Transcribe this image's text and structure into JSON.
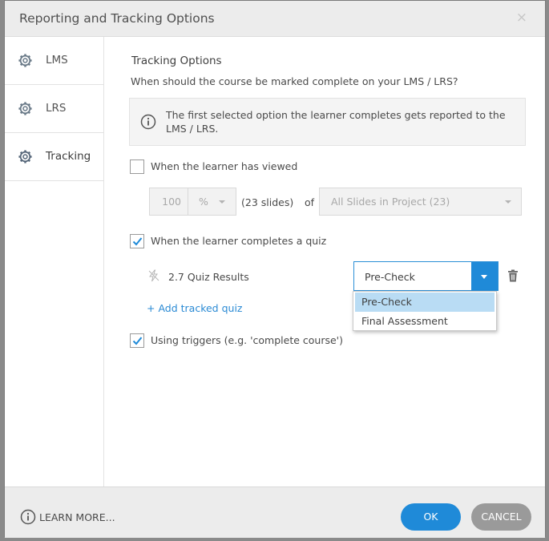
{
  "dialog": {
    "title": "Reporting and Tracking Options",
    "close_glyph": "×"
  },
  "sidebar": {
    "items": [
      {
        "label": "LMS",
        "icon": "gear-icon",
        "active": false
      },
      {
        "label": "LRS",
        "icon": "gear-icon",
        "active": false
      },
      {
        "label": "Tracking",
        "icon": "gear-icon",
        "active": true
      }
    ]
  },
  "tracking": {
    "title": "Tracking Options",
    "question": "When should the course be marked complete on your LMS / LRS?",
    "info": "The first selected option the learner completes gets reported to the LMS / LRS.",
    "viewed": {
      "label": "When the learner has viewed",
      "checked": false,
      "percent_value": "100",
      "unit": "%",
      "slides_count": "(23 slides)",
      "of_label": "of",
      "slides_select": "All Slides in Project (23)"
    },
    "quiz": {
      "label": "When the learner completes a quiz",
      "checked": true,
      "quiz_name": "2.7 Quiz Results",
      "selected": "Pre-Check",
      "options": [
        "Pre-Check",
        "Final Assessment"
      ],
      "add_label": "+ Add tracked quiz"
    },
    "triggers": {
      "label": "Using triggers (e.g. 'complete course')",
      "checked": true
    }
  },
  "footer": {
    "learn_more": "LEARN MORE...",
    "ok_label": "OK",
    "cancel_label": "CANCEL"
  },
  "colors": {
    "accent": "#1f8ad8",
    "dropdown_highlight": "#b9dcf4",
    "cancel": "#9a9a9a",
    "titlebar": "#ececec"
  }
}
